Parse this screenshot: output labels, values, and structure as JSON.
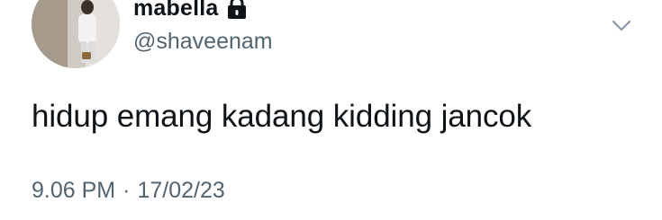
{
  "author": {
    "display_name": "mabella",
    "handle": "@shaveenam",
    "protected": true
  },
  "tweet": {
    "text": "hidup emang kadang kidding jancok",
    "time": "9.06 PM",
    "separator": "·",
    "date": "17/02/23"
  },
  "icons": {
    "lock": "lock-icon",
    "caret": "chevron-down-icon"
  },
  "colors": {
    "primary_text": "#0f1419",
    "secondary_text": "#536471",
    "background": "#ffffff"
  }
}
